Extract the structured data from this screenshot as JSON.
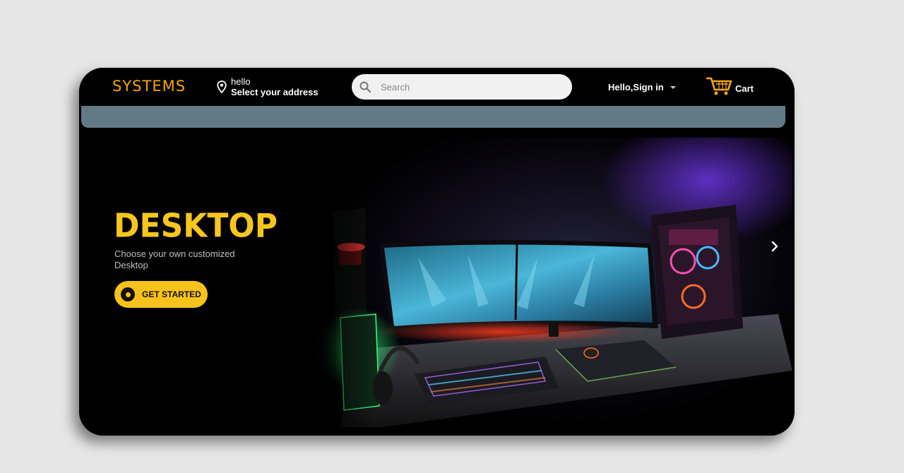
{
  "header": {
    "logo": "SYSTEMS",
    "address_line1": "hello",
    "address_line2": "Select your address",
    "search_placeholder": "Search",
    "signin_label": "Hello,Sign in",
    "cart_label": "Cart"
  },
  "hero": {
    "title": "DESKTOP",
    "subtitle": "Choose your own customized Desktop",
    "cta_label": "GET STARTED"
  },
  "colors": {
    "accent": "#f7c21b",
    "logo": "#f5a60f",
    "subbar": "#627a86",
    "background": "#000000"
  },
  "icons": {
    "address": "location-pin-icon",
    "search": "search-icon",
    "signin": "caret-down-icon",
    "cart": "cart-icon",
    "carousel_next": "chevron-right-icon",
    "cta": "record-dot-icon"
  }
}
